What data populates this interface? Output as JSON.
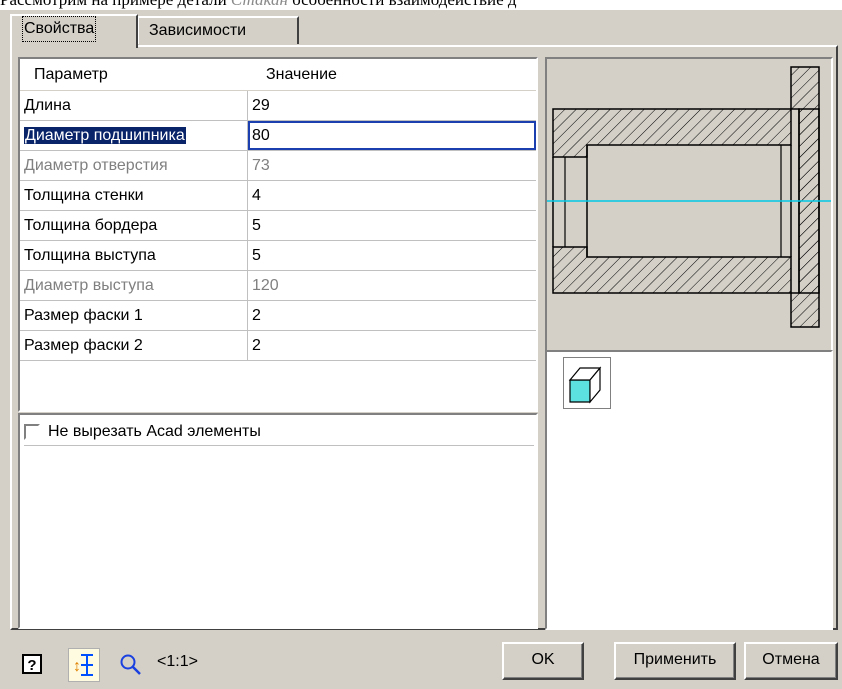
{
  "caption": {
    "prefix": "Рассмотрим на примере детали ",
    "italic": "Стакан",
    "suffix": " особенности взаимодействие д"
  },
  "tabs": [
    {
      "label": "Свойства",
      "active": true
    },
    {
      "label": "Зависимости",
      "active": false
    }
  ],
  "grid": {
    "header_param": "Параметр",
    "header_value": "Значение",
    "rows": [
      {
        "label": "Длина",
        "value": "29",
        "state": "normal"
      },
      {
        "label": "Диаметр подшипника",
        "value": "80",
        "state": "selected"
      },
      {
        "label": "Диаметр отверстия",
        "value": "73",
        "state": "disabled"
      },
      {
        "label": "Толщина стенки",
        "value": "4",
        "state": "normal"
      },
      {
        "label": "Толщина бордера",
        "value": "5",
        "state": "normal"
      },
      {
        "label": "Толщина выступа",
        "value": "5",
        "state": "normal"
      },
      {
        "label": "Диаметр выступа",
        "value": "120",
        "state": "disabled"
      },
      {
        "label": "Размер фаски 1",
        "value": "2",
        "state": "normal"
      },
      {
        "label": "Размер фаски 2",
        "value": "2",
        "state": "normal"
      }
    ]
  },
  "option": {
    "label": "Не вырезать Acad элементы",
    "checked": false
  },
  "toolbar": {
    "scale": "<1:1>",
    "help_icon": "help-icon",
    "params_icon": "parameters-icon",
    "zoom_icon": "magnifier-icon"
  },
  "buttons": {
    "ok": "OK",
    "apply": "Применить",
    "cancel": "Отмена"
  },
  "colors": {
    "face": "#d4d0c8",
    "selection": "#0a246a",
    "axis": "#00c8e6",
    "cube": "#5ce0e0"
  }
}
